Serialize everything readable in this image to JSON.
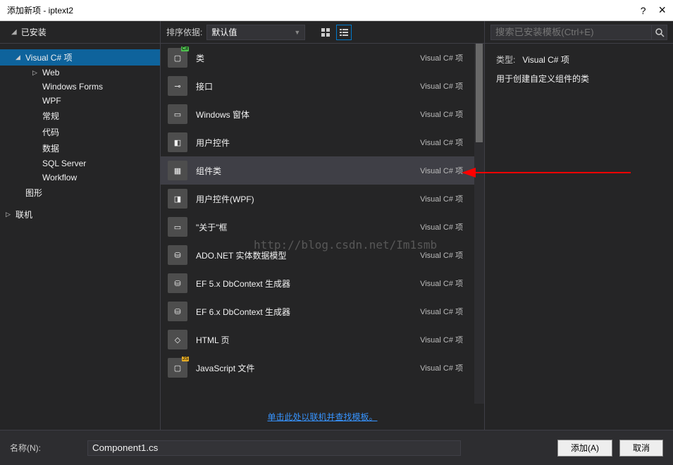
{
  "titlebar": {
    "title": "添加新项 - iptext2",
    "help": "?",
    "close": "×"
  },
  "installed_tab": "已安装",
  "sort": {
    "label": "排序依据:",
    "value": "默认值"
  },
  "search": {
    "placeholder": "搜索已安装模板(Ctrl+E)"
  },
  "sidebar": {
    "items": [
      {
        "label": "Visual C# 项",
        "level": 1,
        "caret": "◢",
        "selected": true
      },
      {
        "label": "Web",
        "level": 2,
        "caret": "▷"
      },
      {
        "label": "Windows Forms",
        "level": 2,
        "caret": ""
      },
      {
        "label": "WPF",
        "level": 2,
        "caret": ""
      },
      {
        "label": "常规",
        "level": 2,
        "caret": ""
      },
      {
        "label": "代码",
        "level": 2,
        "caret": ""
      },
      {
        "label": "数据",
        "level": 2,
        "caret": ""
      },
      {
        "label": "SQL Server",
        "level": 2,
        "caret": ""
      },
      {
        "label": "Workflow",
        "level": 2,
        "caret": ""
      },
      {
        "label": "图形",
        "level": 1,
        "caret": ""
      },
      {
        "label": "联机",
        "level": 0,
        "caret": "▷"
      }
    ]
  },
  "templates": [
    {
      "name": "类",
      "lang": "Visual C# 项",
      "iconBadge": "C#",
      "badgeClass": "cs-badge",
      "glyph": "▢"
    },
    {
      "name": "接口",
      "lang": "Visual C# 项",
      "iconBadge": "",
      "glyph": "⊸"
    },
    {
      "name": "Windows 窗体",
      "lang": "Visual C# 项",
      "iconBadge": "",
      "glyph": "▭"
    },
    {
      "name": "用户控件",
      "lang": "Visual C# 项",
      "iconBadge": "",
      "glyph": "◧"
    },
    {
      "name": "组件类",
      "lang": "Visual C# 项",
      "iconBadge": "",
      "glyph": "▦",
      "selected": true
    },
    {
      "name": "用户控件(WPF)",
      "lang": "Visual C# 项",
      "iconBadge": "",
      "glyph": "◨"
    },
    {
      "name": "\"关于\"框",
      "lang": "Visual C# 项",
      "iconBadge": "",
      "glyph": "▭"
    },
    {
      "name": "ADO.NET 实体数据模型",
      "lang": "Visual C# 项",
      "iconBadge": "",
      "glyph": "⛁"
    },
    {
      "name": "EF 5.x DbContext 生成器",
      "lang": "Visual C# 项",
      "iconBadge": "",
      "glyph": "⛁"
    },
    {
      "name": "EF 6.x DbContext 生成器",
      "lang": "Visual C# 项",
      "iconBadge": "",
      "glyph": "⛁"
    },
    {
      "name": "HTML 页",
      "lang": "Visual C# 项",
      "iconBadge": "",
      "glyph": "◇"
    },
    {
      "name": "JavaScript 文件",
      "lang": "Visual C# 项",
      "iconBadge": "JS",
      "badgeClass": "js-badge",
      "glyph": "▢"
    }
  ],
  "online_link": "单击此处以联机并查找模板。",
  "details": {
    "type_label": "类型:",
    "type_value": "Visual C# 项",
    "description": "用于创建自定义组件的类"
  },
  "name": {
    "label": "名称(N):",
    "value": "Component1.cs"
  },
  "buttons": {
    "add": "添加(A)",
    "cancel": "取消"
  },
  "watermark": "http://blog.csdn.net/Im1smb"
}
